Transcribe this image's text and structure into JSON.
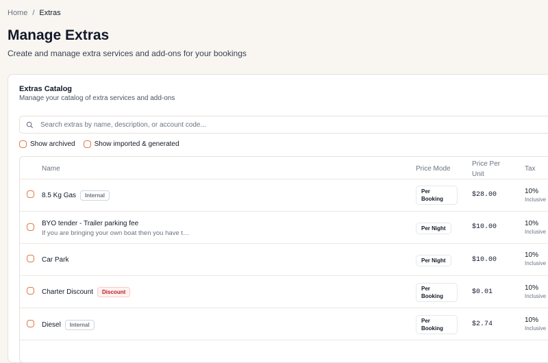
{
  "breadcrumb": {
    "home": "Home",
    "separator": "/",
    "current": "Extras"
  },
  "page": {
    "title": "Manage Extras",
    "subtitle": "Create and manage extra services and add-ons for your bookings"
  },
  "catalog": {
    "title": "Extras Catalog",
    "description": "Manage your catalog of extra services and add-ons",
    "search_placeholder": "Search extras by name, description, or account code...",
    "filters": {
      "show_archived": "Show archived",
      "show_imported": "Show imported & generated"
    },
    "columns": {
      "name": "Name",
      "price_mode": "Price Mode",
      "price_per_unit": "Price Per Unit",
      "tax": "Tax"
    },
    "rows": [
      {
        "name": "8.5 Kg Gas",
        "badge": "Internal",
        "description": "",
        "price_mode": "Per Booking",
        "price": "$28.00",
        "tax": "10%",
        "tax_note": "Inclusive"
      },
      {
        "name": "BYO tender - Trailer parking fee",
        "badge": "",
        "description": "If you are bringing your own boat then you have t…",
        "price_mode": "Per Night",
        "price": "$10.00",
        "tax": "10%",
        "tax_note": "Inclusive"
      },
      {
        "name": "Car Park",
        "badge": "",
        "description": "",
        "price_mode": "Per Night",
        "price": "$10.00",
        "tax": "10%",
        "tax_note": "Inclusive"
      },
      {
        "name": "Charter Discount",
        "badge": "Discount",
        "description": "",
        "price_mode": "Per Booking",
        "price": "$0.01",
        "tax": "10%",
        "tax_note": "Inclusive"
      },
      {
        "name": "Diesel",
        "badge": "Internal",
        "description": "",
        "price_mode": "Per Booking",
        "price": "$2.74",
        "tax": "10%",
        "tax_note": "Inclusive"
      }
    ]
  },
  "colors": {
    "accent": "#e07a3f",
    "discount": "#b91c1c",
    "background": "#f9f6f2"
  },
  "icons": {
    "search": "search-icon"
  }
}
